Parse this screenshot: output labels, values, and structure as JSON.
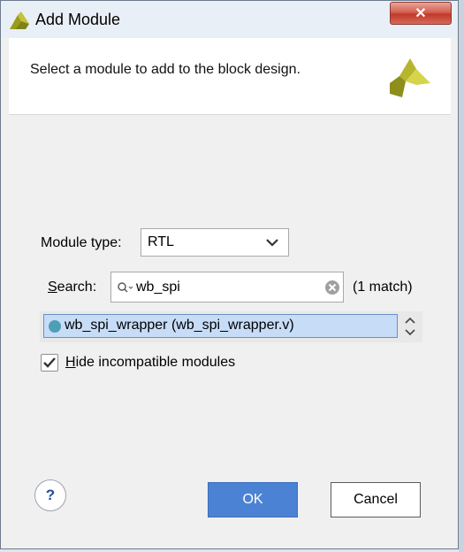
{
  "window": {
    "title": "Add Module",
    "close_label": "✕"
  },
  "header": {
    "instruction": "Select a module to add to the block design."
  },
  "form": {
    "module_type_label": "Module type:",
    "module_type_value": "RTL",
    "search_label_first": "S",
    "search_label_rest": "earch:",
    "search_value": "wb_spi",
    "match_count": "(1 match)"
  },
  "list": {
    "items": [
      {
        "label": "wb_spi_wrapper (wb_spi_wrapper.v)",
        "selected": true
      }
    ]
  },
  "options": {
    "hide_incompatible_first": "H",
    "hide_incompatible_rest": "ide incompatible modules",
    "hide_incompatible_checked": true
  },
  "footer": {
    "help_label": "?",
    "ok_label": "OK",
    "cancel_label": "Cancel"
  },
  "icons": {
    "title_logo": "xilinx-logo-icon",
    "header_logo": "xilinx-logo-icon",
    "dropdown": "chevron-down-icon",
    "search": "search-icon",
    "clear": "clear-icon",
    "spinner": "spinner-icon",
    "status_dot": "module-dot-icon"
  },
  "colors": {
    "accent": "#4b82d4",
    "selection": "#c7dcf7",
    "logo": "#b7b52c"
  }
}
